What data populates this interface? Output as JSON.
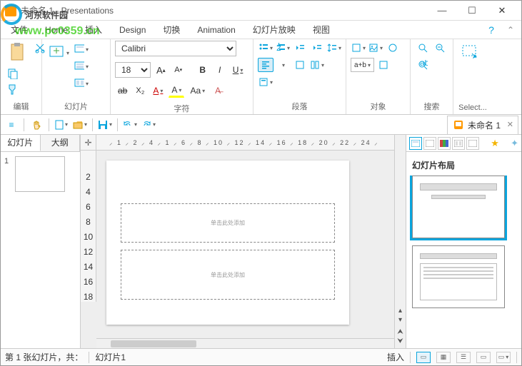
{
  "window": {
    "title": "未命名 1 - Presentations"
  },
  "watermark": {
    "line1": "河东软件园",
    "line2": "www.pc0359.cn"
  },
  "menu": {
    "items": [
      "文件",
      "Home",
      "插入",
      "Design",
      "切换",
      "Animation",
      "幻灯片放映",
      "视图"
    ],
    "help": "?"
  },
  "ribbon": {
    "edit": {
      "label": "编辑"
    },
    "slides": {
      "label": "幻灯片"
    },
    "font": {
      "label": "字符",
      "name": "Calibri",
      "size": "18",
      "buttons": {
        "growA": "A▴",
        "shrinkA": "A▾",
        "B": "B",
        "I": "I",
        "U": "U",
        "ab": "ab",
        "X": "X",
        "Ared": "A",
        "Ayel": "A",
        "Aa": "Aa"
      }
    },
    "para": {
      "label": "段落"
    },
    "obj": {
      "label": "对象",
      "ab": "a+b"
    },
    "search": {
      "label": "搜索"
    },
    "select": {
      "label": "Select..."
    }
  },
  "docTab": {
    "name": "未命名 1"
  },
  "left": {
    "tabs": [
      "幻灯片",
      "大纲"
    ],
    "slideNum": "1"
  },
  "ruler": {
    "h": "⸝ 1 ⸝ 2 ⸝ 4 ⸝ 1 ⸝ 6 ⸝ 8 ⸝ 10 ⸝ 12 ⸝ 14 ⸝ 16 ⸝ 18 ⸝ 20 ⸝ 22 ⸝ 24 ⸝",
    "v": [
      "2",
      "4",
      "6",
      "8",
      "10",
      "12",
      "14",
      "16",
      "18"
    ]
  },
  "slide": {
    "ph1": "单击此处添加",
    "ph2": "单击此处添加"
  },
  "right": {
    "title": "幻灯片布局"
  },
  "status": {
    "slide_info": "第 1 张幻灯片，共：",
    "slide_name": "幻灯片1",
    "mode": "插入"
  }
}
